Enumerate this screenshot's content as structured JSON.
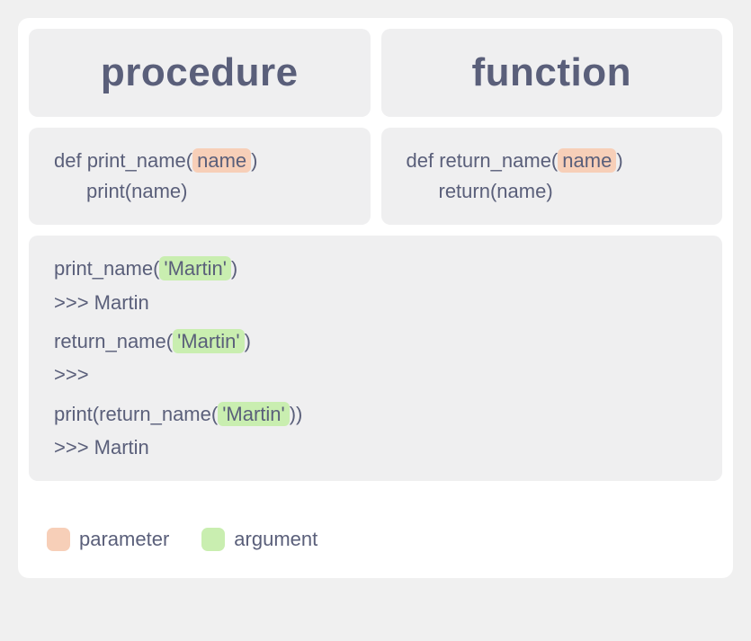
{
  "headers": {
    "left": "procedure",
    "right": "function"
  },
  "defs": {
    "left": {
      "line1_pre": "def print_name(",
      "line1_param": "name",
      "line1_post": ")",
      "line2": "print(name)"
    },
    "right": {
      "line1_pre": "def return_name(",
      "line1_param": "name",
      "line1_post": ")",
      "line2": "return(name)"
    }
  },
  "exec": {
    "l1_pre": "print_name(",
    "l1_arg": "'Martin'",
    "l1_post": ")",
    "l2": ">>> Martin",
    "l3_pre": "return_name(",
    "l3_arg": "'Martin'",
    "l3_post": ")",
    "l4": ">>>",
    "l5_pre": "print(return_name(",
    "l5_arg": "'Martin'",
    "l5_post": "))",
    "l6": ">>> Martin"
  },
  "legend": {
    "parameter": "parameter",
    "argument": "argument"
  },
  "colors": {
    "param_bg": "#f7cfb8",
    "arg_bg": "#c9eeb0",
    "panel_bg": "#efeff0",
    "text": "#5a5f7a"
  }
}
